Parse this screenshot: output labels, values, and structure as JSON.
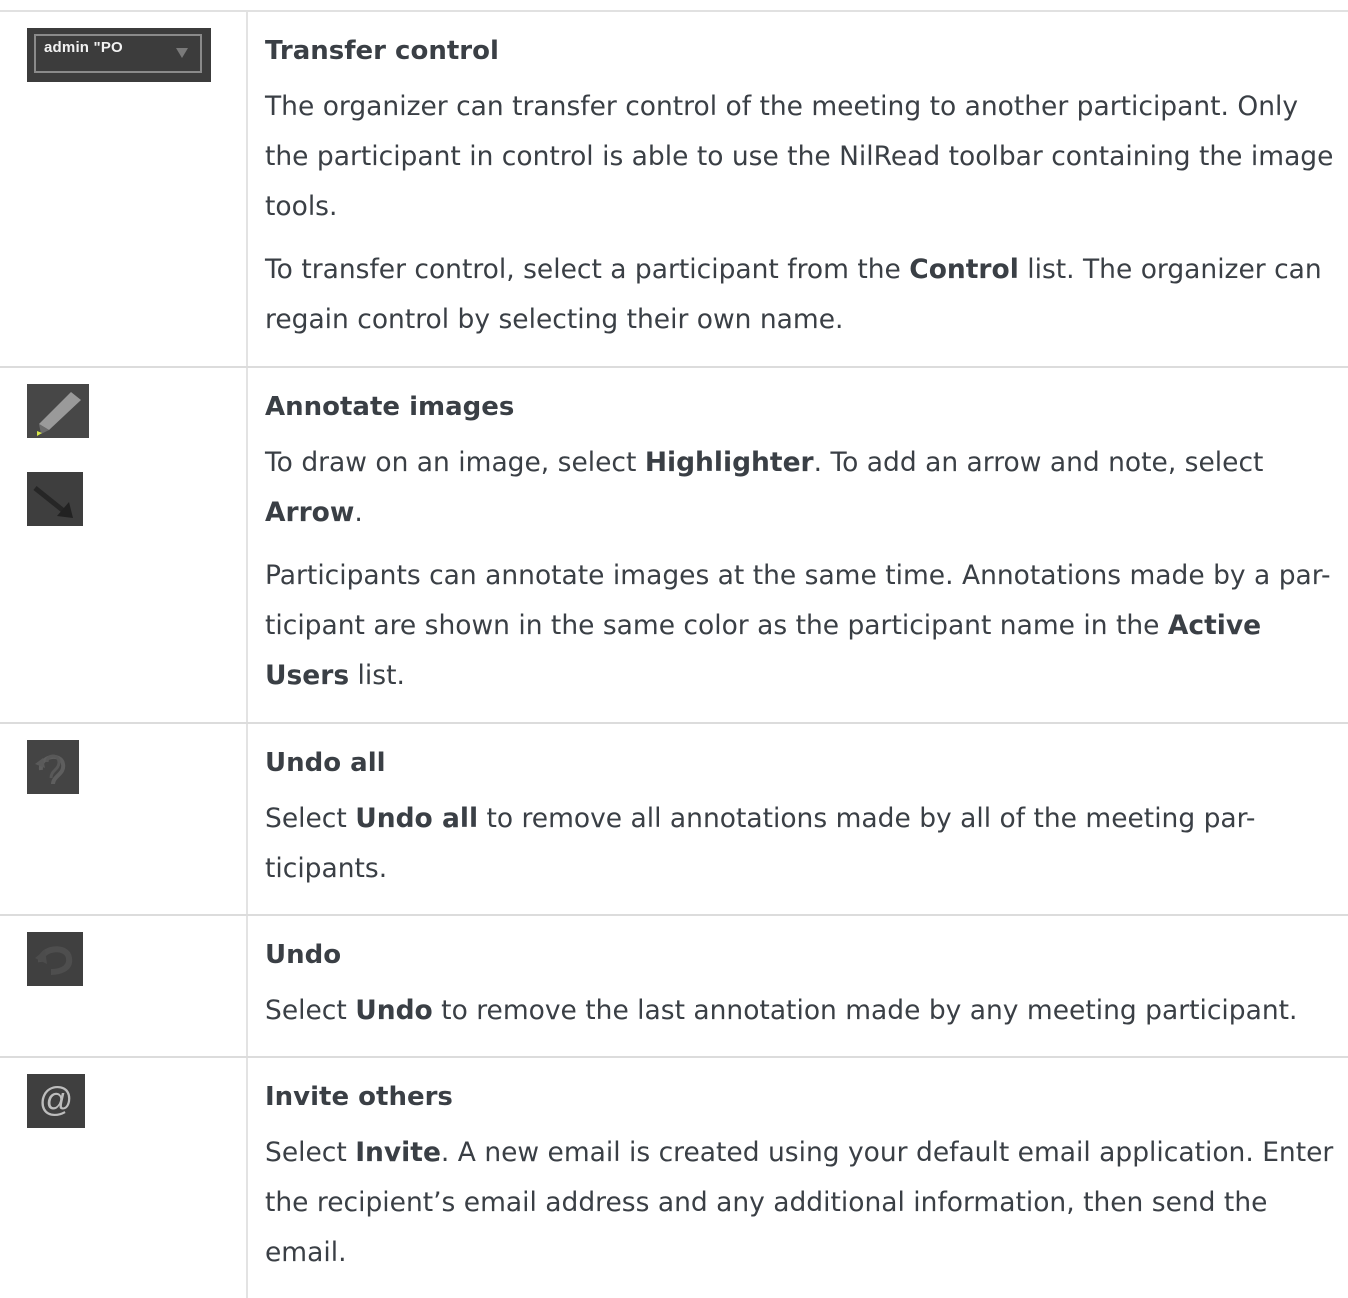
{
  "rows": [
    {
      "icons": [
        {
          "name": "control-dropdown-icon",
          "label": "admin \"PO"
        }
      ],
      "heading": "Transfer control",
      "paragraphs": [
        [
          {
            "t": "The organizer can transfer control of the meeting to another participant. Only the participant in control is able to use the NilRead toolbar containing the image tools."
          }
        ],
        [
          {
            "t": "To transfer control, select a participant from the "
          },
          {
            "t": "Control",
            "b": true
          },
          {
            "t": " list. The organizer can regain control by selecting their own name."
          }
        ]
      ]
    },
    {
      "icons": [
        {
          "name": "highlighter-icon"
        },
        {
          "name": "arrow-icon"
        }
      ],
      "heading": "Annotate images",
      "paragraphs": [
        [
          {
            "t": "To draw on an image, select "
          },
          {
            "t": "Highlighter",
            "b": true
          },
          {
            "t": ". To add an arrow and note, select "
          },
          {
            "t": "Arrow",
            "b": true
          },
          {
            "t": "."
          }
        ],
        [
          {
            "t": "Participants can annotate images at the same time. Annotations made by a par-ticipant are shown in the same color as the participant name in the "
          },
          {
            "t": "Active Users",
            "b": true
          },
          {
            "t": " list."
          }
        ]
      ]
    },
    {
      "icons": [
        {
          "name": "undo-all-icon"
        }
      ],
      "heading": "Undo all",
      "paragraphs": [
        [
          {
            "t": "Select "
          },
          {
            "t": "Undo all",
            "b": true
          },
          {
            "t": " to remove all annotations made by all of the meeting par-ticipants."
          }
        ]
      ]
    },
    {
      "icons": [
        {
          "name": "undo-icon"
        }
      ],
      "heading": "Undo",
      "paragraphs": [
        [
          {
            "t": "Select "
          },
          {
            "t": "Undo",
            "b": true
          },
          {
            "t": " to remove the last annotation made by any meeting participant."
          }
        ]
      ]
    },
    {
      "icons": [
        {
          "name": "invite-at-icon"
        }
      ],
      "heading": "Invite others",
      "paragraphs": [
        [
          {
            "t": "Select "
          },
          {
            "t": "Invite",
            "b": true
          },
          {
            "t": ". A new email is created using your default email application. Enter the recipient’s email address and any additional information, then send the email."
          }
        ]
      ]
    }
  ]
}
